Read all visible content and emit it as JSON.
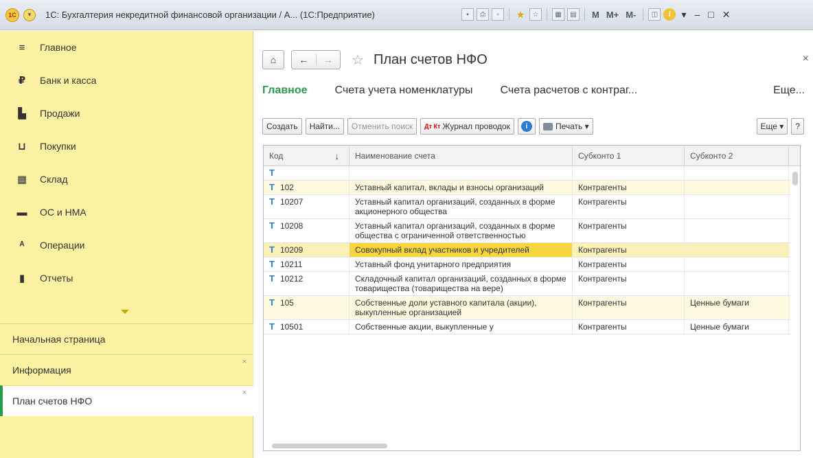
{
  "titlebar": {
    "logo": "1С",
    "title": "1С: Бухгалтерия некредитной финансовой организации / А... (1С:Предприятие)",
    "m_labels": [
      "M",
      "M+",
      "M-"
    ],
    "window_controls": [
      "–",
      "□",
      "✕"
    ]
  },
  "sidebar": {
    "items": [
      {
        "label": "Главное",
        "icon": "menu-lines-icon"
      },
      {
        "label": "Банк и касса",
        "icon": "ruble-coin-icon"
      },
      {
        "label": "Продажи",
        "icon": "bag-icon"
      },
      {
        "label": "Покупки",
        "icon": "cart-icon"
      },
      {
        "label": "Склад",
        "icon": "warehouse-icon"
      },
      {
        "label": "ОС и НМА",
        "icon": "truck-icon"
      },
      {
        "label": "Операции",
        "icon": "debit-credit-icon"
      },
      {
        "label": "Отчеты",
        "icon": "bar-chart-icon"
      }
    ],
    "open_windows": [
      {
        "label": "Начальная страница",
        "closable": false
      },
      {
        "label": "Информация",
        "closable": true
      },
      {
        "label": "План счетов НФО",
        "closable": true,
        "active": true
      }
    ]
  },
  "main": {
    "title": "План счетов НФО",
    "tabs": [
      {
        "label": "Главное",
        "active": true
      },
      {
        "label": "Счета учета номенклатуры"
      },
      {
        "label": "Счета расчетов с контраг..."
      }
    ],
    "tabs_more": "Еще...",
    "toolbar": {
      "create": "Создать",
      "find": "Найти...",
      "cancel_search": "Отменить поиск",
      "journal_icon_text": "Дт Кт",
      "journal": "Журнал проводок",
      "print": "Печать",
      "more": "Еще",
      "help": "?"
    },
    "table": {
      "headers": [
        "Код",
        "Наименование счета",
        "Субконто 1",
        "Субконто 2"
      ],
      "rows": [
        {
          "code": "",
          "name": "",
          "sub1": "",
          "sub2": "",
          "yellow": false
        },
        {
          "code": "102",
          "name": "Уставный капитал, вклады и взносы организаций",
          "sub1": "Контрагенты",
          "sub2": "",
          "yellow": true
        },
        {
          "code": "10207",
          "name": "Уставный капитал организаций, созданных в форме акционерного общества",
          "sub1": "Контрагенты",
          "sub2": "",
          "yellow": false
        },
        {
          "code": "10208",
          "name": "Уставный капитал организаций, созданных в форме общества с ограниченной ответственностью",
          "sub1": "Контрагенты",
          "sub2": "",
          "yellow": false
        },
        {
          "code": "10209",
          "name": "Совокупный вклад участников и учредителей",
          "sub1": "Контрагенты",
          "sub2": "",
          "yellow": true,
          "selected": true
        },
        {
          "code": "10211",
          "name": "Уставный фонд унитарного предприятия",
          "sub1": "Контрагенты",
          "sub2": "",
          "yellow": false
        },
        {
          "code": "10212",
          "name": "Складочный капитал организаций, созданных в форме товарищества (товарищества на вере)",
          "sub1": "Контрагенты",
          "sub2": "",
          "yellow": false
        },
        {
          "code": "105",
          "name": "Собственные доли уставного капитала (акции), выкупленные организацией",
          "sub1": "Контрагенты",
          "sub2": "Ценные бумаги",
          "yellow": true
        },
        {
          "code": "10501",
          "name": "Собственные акции, выкупленные у",
          "sub1": "Контрагенты",
          "sub2": "Ценные бумаги",
          "yellow": false
        }
      ]
    }
  },
  "colors": {
    "sidebar_bg": "#fbf3a3",
    "accent_green": "#2d9b4f",
    "selection": "#f8d53c",
    "row_highlight": "#fdfae0"
  }
}
